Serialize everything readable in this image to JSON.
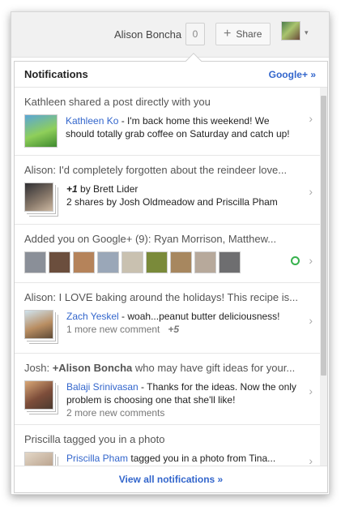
{
  "topbar": {
    "user_name": "Alison Boncha",
    "notification_count": "0",
    "share_label": "Share",
    "share_plus": "+",
    "avatar_chevron": "▾"
  },
  "panel": {
    "title": "Notifications",
    "gplus_link": "Google+ »",
    "footer_link": "View all notifications »"
  },
  "notifications": [
    {
      "head": "Kathleen shared a post directly with you",
      "author": "Kathleen Ko",
      "text": " - I'm back home this weekend! We should totally grab coffee on Saturday and catch up!"
    },
    {
      "head": "Alison: I'd completely forgotten about the reindeer love...",
      "plus_one": "+1",
      "by": " by Brett Lider",
      "shares": "2 shares by Josh Oldmeadow and Priscilla Pham"
    },
    {
      "head": "Added you on Google+ (9): Ryan Morrison, Matthew..."
    },
    {
      "head": "Alison: I LOVE baking around the holidays! This recipe is...",
      "author": "Zach Yeskel",
      "text": " - woah...peanut butter deliciousness!",
      "more": "1 more new comment",
      "plus": "+5"
    },
    {
      "head_prefix": "Josh: ",
      "head_mention": "+Alison Boncha",
      "head_suffix": " who may have gift ideas for your...",
      "author": "Balaji Srinivasan",
      "text": " - Thanks for the ideas. Now the only problem is choosing one that she'll like!",
      "more": "2 more new comments"
    },
    {
      "head": "Priscilla tagged you in a photo",
      "author": "Priscilla Pham",
      "text": " tagged you in a photo from Tina..."
    }
  ],
  "chevron_glyph": "›",
  "colors": {
    "link": "#3366cc",
    "online": "#37b24d",
    "face_colors": [
      "#8a8f98",
      "#6b4e3d",
      "#b5835a",
      "#9aa7b8",
      "#c9c1b0",
      "#7a8a3a",
      "#a7875f",
      "#b7a99b",
      "#6e6e70"
    ]
  }
}
